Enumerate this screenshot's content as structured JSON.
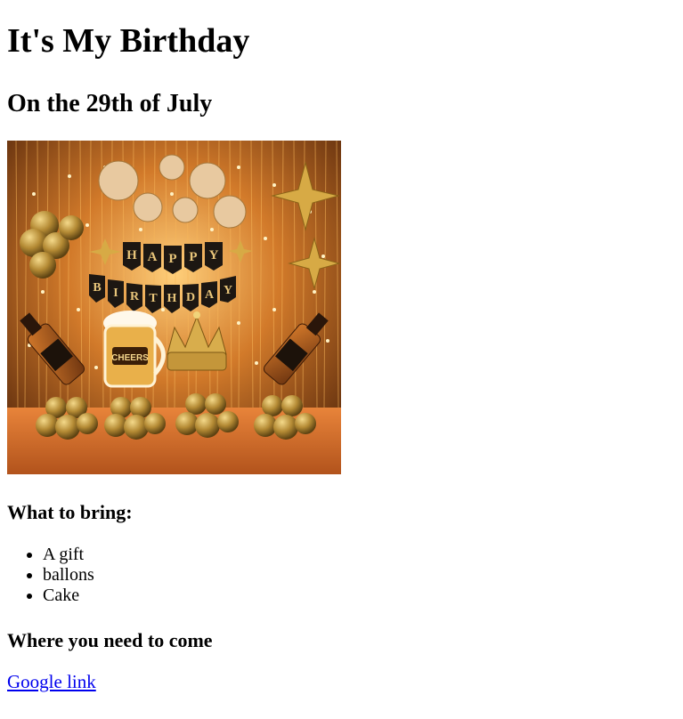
{
  "page": {
    "title": "It's My Birthday",
    "date": "On the 29th of July"
  },
  "photo": {
    "banner_top": [
      "H",
      "A",
      "P",
      "P",
      "Y"
    ],
    "banner_bottom": [
      "B",
      "I",
      "R",
      "T",
      "H",
      "D",
      "A",
      "Y"
    ],
    "mug_label": "CHEERS",
    "colors": {
      "background": "#7a3b10",
      "gold": "#c9a23c",
      "glow": "#ffb347"
    }
  },
  "bring": {
    "heading": "What to bring:",
    "items": [
      "A gift",
      "ballons",
      "Cake"
    ]
  },
  "location": {
    "heading": "Where you need to come",
    "link_text": "Google link"
  }
}
